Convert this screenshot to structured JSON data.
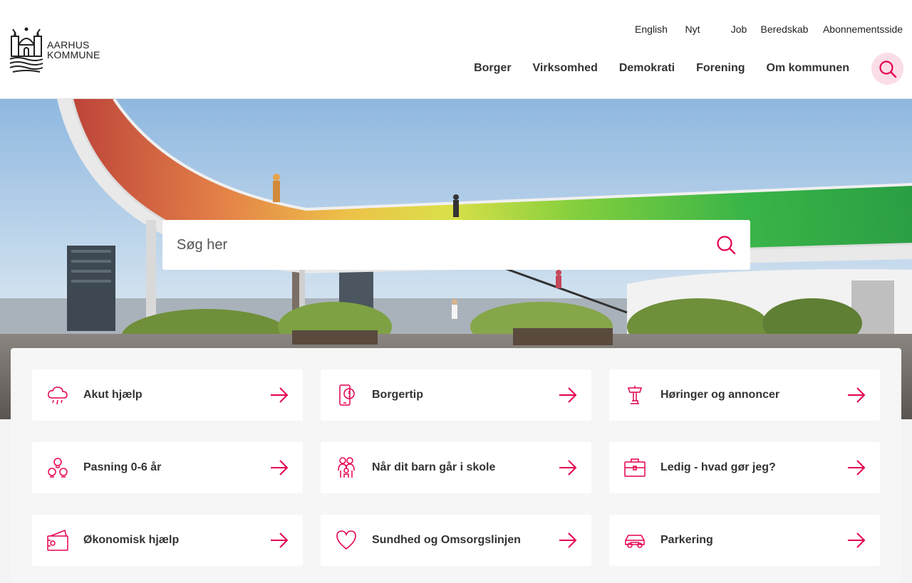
{
  "logo": {
    "line1": "AARHUS",
    "line2": "KOMMUNE"
  },
  "utility_nav": [
    "English",
    "Nyt",
    "Job",
    "Beredskab",
    "Abonnementsside"
  ],
  "main_nav": [
    "Borger",
    "Virksomhed",
    "Demokrati",
    "Forening",
    "Om kommunen"
  ],
  "search": {
    "placeholder": "Søg her"
  },
  "accent_color": "#e5004f",
  "quick_links": [
    {
      "label": "Akut hjælp",
      "icon": "cloud-rain-icon"
    },
    {
      "label": "Borgertip",
      "icon": "phone-alert-icon"
    },
    {
      "label": "Høringer og annoncer",
      "icon": "podium-icon"
    },
    {
      "label": "Pasning 0-6 år",
      "icon": "children-icon"
    },
    {
      "label": "Når dit barn går i skole",
      "icon": "family-icon"
    },
    {
      "label": "Ledig - hvad gør jeg?",
      "icon": "briefcase-icon"
    },
    {
      "label": "Økonomisk hjælp",
      "icon": "wallet-icon"
    },
    {
      "label": "Sundhed og Omsorgslinjen",
      "icon": "heart-icon"
    },
    {
      "label": "Parkering",
      "icon": "car-icon"
    }
  ]
}
